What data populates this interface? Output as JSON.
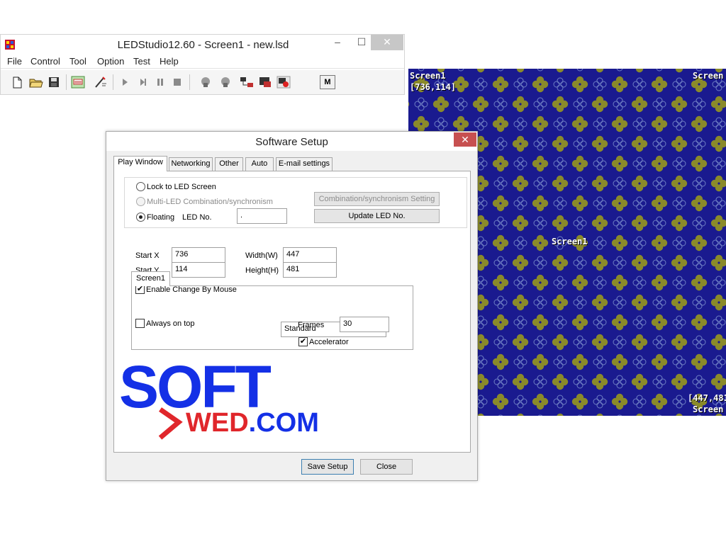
{
  "app": {
    "title": "LEDStudio12.60 - Screen1 - new.lsd",
    "minimize_glyph": "–",
    "maximize_glyph": "☐",
    "close_glyph": "✕"
  },
  "menu": [
    "File",
    "Control",
    "Tool",
    "Option",
    "Test",
    "Help"
  ],
  "toolbar": {
    "icons": [
      "new-file-icon",
      "open-folder-icon",
      "save-disk-icon",
      "led-screen-icon",
      "edit-wand-icon",
      "play-icon",
      "step-play-icon",
      "pause-icon",
      "stop-icon",
      "lock-icon",
      "unlock-icon",
      "network-icon",
      "display-icon",
      "record-icon"
    ],
    "m_label": "M"
  },
  "led_screen": {
    "background": "#1a1a8f",
    "pattern_color": "#8a8a2a",
    "label_top_left": "Screen1",
    "coords_top_left": "[736,114]",
    "label_top_right": "Screen",
    "label_center": "Screen1",
    "coords_bottom_right": "[447,481",
    "label_bottom_right": "Screen"
  },
  "dialog": {
    "title": "Software Setup",
    "close_glyph": "✕",
    "tabs": [
      "Play Window",
      "Networking",
      "Other",
      "Auto",
      "E-mail settings"
    ],
    "options": {
      "lock_to_led": "Lock to LED Screen",
      "multi_led": "Multi-LED Combination/synchronism",
      "floating": "Floating",
      "led_no_label": "LED No.",
      "led_no_value": ".",
      "combination_button": "Combination/synchronism Setting",
      "update_button": "Update LED No."
    },
    "screen_group": {
      "tab": "Screen1",
      "start_x_label": "Start X",
      "start_x": "736",
      "start_y_label": "Start Y",
      "start_y": "114",
      "width_label": "Width(W)",
      "width": "447",
      "height_label": "Height(H)",
      "height": "481",
      "enable_mouse_label": "Enable Change By Mouse",
      "enable_mouse_checked": true,
      "mode_selected": "Standard",
      "dropdown_arrow": "⌄"
    },
    "always_on_top_label": "Always on top",
    "always_on_top_checked": false,
    "frames_label": "Frames",
    "frames_value": "30",
    "accelerator_label": "Accelerator",
    "accelerator_checked": true,
    "save_button": "Save Setup",
    "close_button": "Close",
    "check_glyph": "✔"
  },
  "watermark": {
    "line1": "SOFT",
    "line2_red": "WED",
    "line2_blue": ".COM",
    "blue": "#1430e6",
    "red": "#e0262b"
  }
}
